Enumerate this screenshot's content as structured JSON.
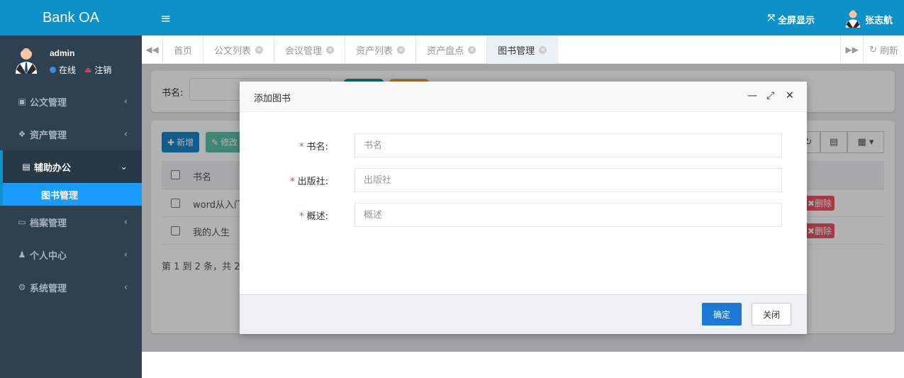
{
  "app": {
    "logo": "Bank OA"
  },
  "user_panel": {
    "username": "admin",
    "online_label": "在线",
    "logout_label": "注销"
  },
  "sidebar": {
    "items": [
      {
        "label": "公文管理",
        "icon": "briefcase-icon"
      },
      {
        "label": "资产管理",
        "icon": "cubes-icon"
      },
      {
        "label": "辅助办公",
        "icon": "file-icon",
        "expanded": true
      },
      {
        "label": "档案管理",
        "icon": "drive-icon"
      },
      {
        "label": "个人中心",
        "icon": "person-icon"
      },
      {
        "label": "系统管理",
        "icon": "gear-icon"
      }
    ],
    "sub_item": "图书管理"
  },
  "topbar": {
    "fullscreen_label": "全屏显示",
    "user_name": "张志航"
  },
  "tabs": {
    "items": [
      "首页",
      "公文列表",
      "会议管理",
      "资产列表",
      "资产盘点",
      "图书管理"
    ],
    "active": "图书管理",
    "refresh_label": "刷新"
  },
  "search": {
    "label": "书名:"
  },
  "toolbar": {
    "add_label": "新增",
    "edit_label": "修改"
  },
  "table": {
    "header": "书名",
    "rows": [
      {
        "name": "word从入门",
        "delete_label": "删除"
      },
      {
        "name": "我的人生",
        "delete_label": "删除"
      }
    ],
    "pager_text": "第 1 到 2 条，共 2 条"
  },
  "modal": {
    "title": "添加图书",
    "fields": [
      {
        "label": "书名:",
        "placeholder": "书名"
      },
      {
        "label": "出版社:",
        "placeholder": "出版社"
      },
      {
        "label": "概述:",
        "placeholder": "概述"
      }
    ],
    "ok_label": "确定",
    "close_label": "关闭"
  },
  "colors": {
    "primary": "#0e90c9",
    "sidebar": "#2f4050",
    "danger": "#ed5565",
    "button_primary": "#1c7ad6"
  }
}
